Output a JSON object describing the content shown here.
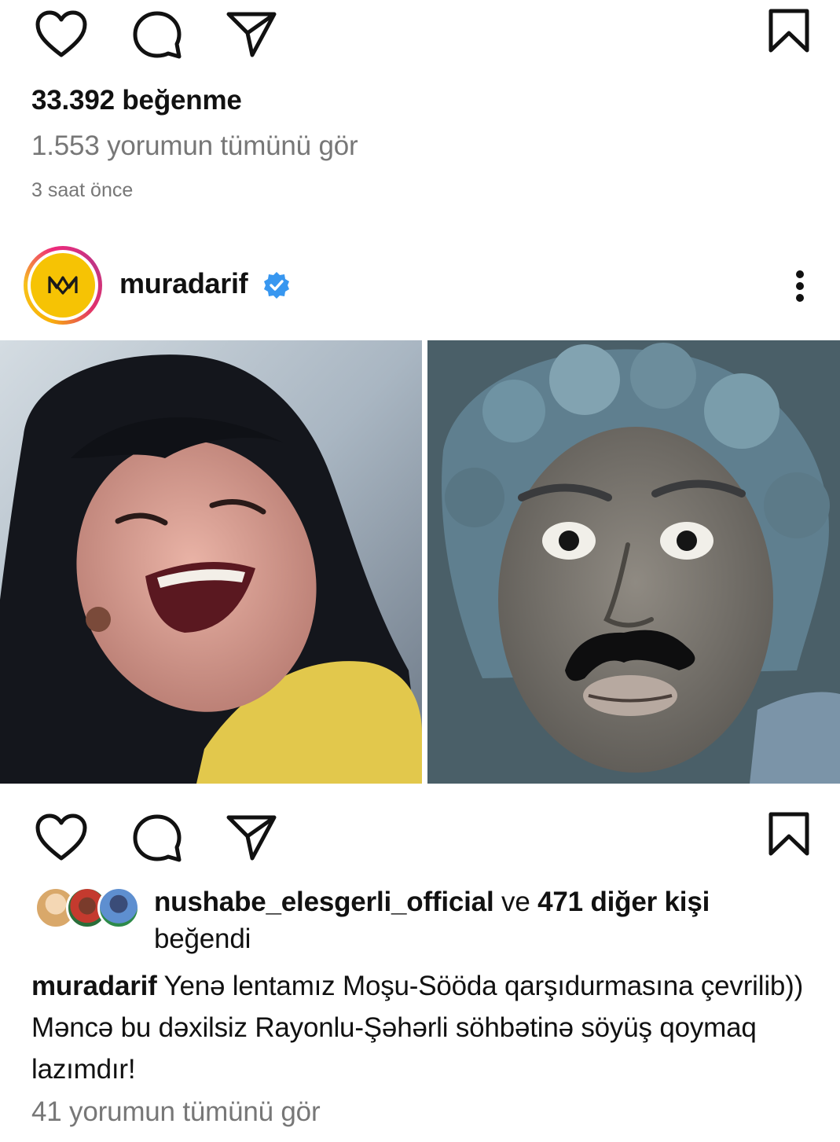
{
  "top_post": {
    "like_count": "33.392 beğenme",
    "view_comments": "1.553 yorumun tümünü gör",
    "timestamp": "3 saat önce"
  },
  "post": {
    "username": "muradarif",
    "verified": true,
    "avatar_icon": "mm-logo-icon",
    "more_icon": "more-vertical-icon",
    "media_panels": [
      {
        "name": "media-left-panel",
        "subject": "woman-laughing"
      },
      {
        "name": "media-right-panel",
        "subject": "man-with-mustache"
      }
    ],
    "liked_by": {
      "user": "nushabe_elesgerli_official",
      "connector": "ve",
      "others": "471 diğer kişi",
      "verb": "beğendi"
    },
    "caption": {
      "author": "muradarif",
      "text": "Yenə lentamız Moşu-Sööda qarşıdurmasına çevrilib)) Məncə bu dəxilsiz Rayonlu-Şəhərli söhbətinə söyüş qoymaq lazımdır!"
    },
    "view_comments": "41 yorumun tümünü gör"
  },
  "icons": {
    "like": "heart-icon",
    "comment": "comment-icon",
    "share": "send-icon",
    "save": "bookmark-icon",
    "verified": "verified-badge-icon"
  },
  "colors": {
    "text_primary": "#111111",
    "text_secondary": "#777777",
    "verified_blue": "#3897f0",
    "avatar_yellow": "#f6c304"
  }
}
